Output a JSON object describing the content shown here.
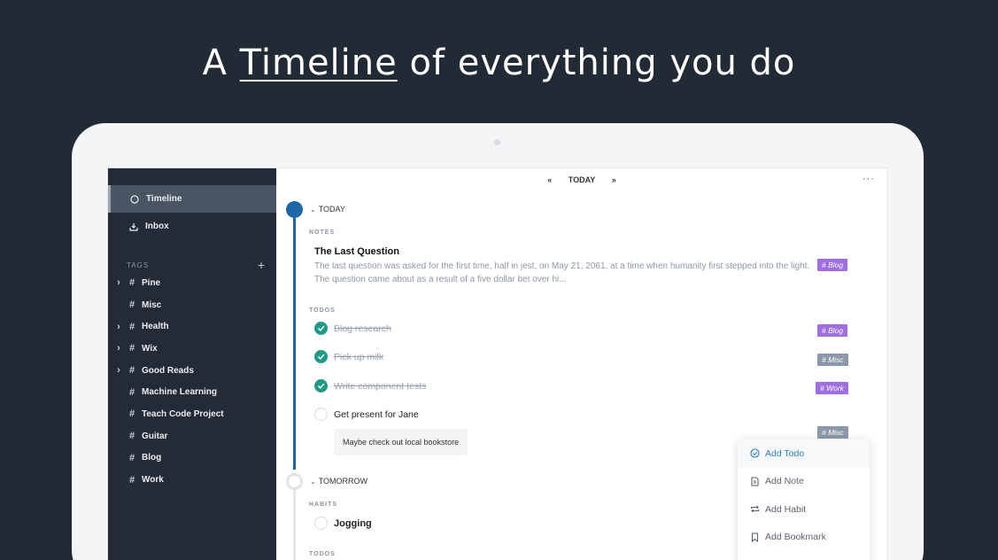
{
  "hero": {
    "prefix": "A ",
    "highlight": "Timeline",
    "suffix": " of everything you do"
  },
  "sidebar": {
    "nav": [
      {
        "label": "Timeline",
        "icon": "circle-icon",
        "active": true
      },
      {
        "label": "Inbox",
        "icon": "inbox-icon",
        "active": false
      }
    ],
    "tags_header": "TAGS",
    "tags": [
      {
        "label": "Pine",
        "expandable": true
      },
      {
        "label": "Misc",
        "expandable": false
      },
      {
        "label": "Health",
        "expandable": true
      },
      {
        "label": "Wix",
        "expandable": true
      },
      {
        "label": "Good Reads",
        "expandable": true
      },
      {
        "label": "Machine Learning",
        "expandable": false
      },
      {
        "label": "Teach Code Project",
        "expandable": false
      },
      {
        "label": "Guitar",
        "expandable": false
      },
      {
        "label": "Blog",
        "expandable": false
      },
      {
        "label": "Work",
        "expandable": false
      }
    ]
  },
  "topbar": {
    "prev": "«",
    "label": "TODAY",
    "next": "»",
    "more": "···"
  },
  "today": {
    "label": "TODAY",
    "notes_header": "NOTES",
    "note": {
      "title": "The Last Question",
      "body": "The last question was asked for the first time, half in jest, on May 21, 2061, at a time when humanity first stepped into the light. The question came about as a result of a five dollar bet over hi...",
      "tag": "# Blog"
    },
    "todos_header": "TODOS",
    "todos": [
      {
        "text": "Blog research",
        "done": true,
        "tag": "# Blog"
      },
      {
        "text": "Pick up milk",
        "done": true,
        "tag": "# Misc"
      },
      {
        "text": "Write component tests",
        "done": true,
        "tag": "# Work"
      },
      {
        "text": "Get present for Jane",
        "done": false,
        "tag": "# Misc"
      }
    ],
    "subnote": "Maybe check out local bookstore"
  },
  "tomorrow": {
    "label": "TOMORROW",
    "habits_header": "HABITS",
    "habit": "Jogging",
    "todos_header": "TODOS"
  },
  "menu": {
    "items": [
      {
        "label": "Add Todo",
        "icon": "check-circle-icon"
      },
      {
        "label": "Add Note",
        "icon": "document-icon"
      },
      {
        "label": "Add Habit",
        "icon": "repeat-icon"
      },
      {
        "label": "Add Bookmark",
        "icon": "bookmark-icon"
      }
    ]
  },
  "colors": {
    "accent": "#1c67a6",
    "check": "#1f9a85",
    "tag_purple": "#a06ee3",
    "tag_grey": "#8a98a9",
    "sidebar": "#242b36",
    "background": "#222a36"
  }
}
